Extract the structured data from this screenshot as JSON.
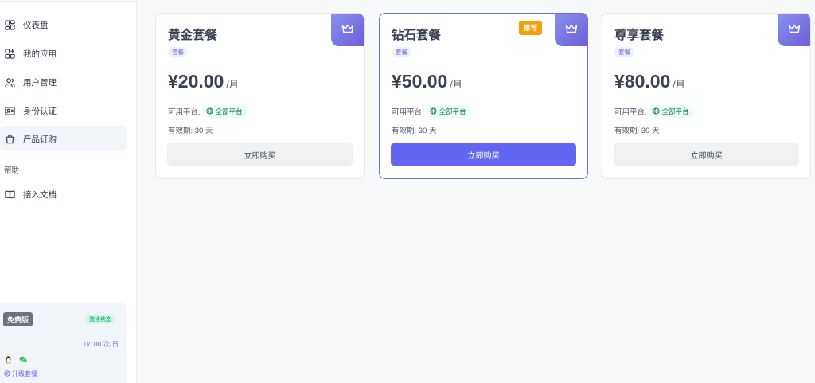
{
  "sidebar": {
    "items": [
      {
        "label": "仪表盘",
        "icon": "dashboard-icon"
      },
      {
        "label": "我的应用",
        "icon": "apps-icon"
      },
      {
        "label": "用户管理",
        "icon": "users-icon"
      },
      {
        "label": "身份认证",
        "icon": "id-card-icon"
      },
      {
        "label": "产品订购",
        "icon": "shopping-bag-icon",
        "active": true
      }
    ],
    "help_section": "帮助",
    "help_items": [
      {
        "label": "接入文档",
        "icon": "book-icon"
      }
    ],
    "plan": {
      "name": "免费版",
      "status": "激活状态",
      "usage": "0/100 次/日",
      "upgrade": "升级套餐",
      "contact_icons": [
        "qq-icon",
        "wechat-icon"
      ]
    }
  },
  "cards": [
    {
      "title": "黄金套餐",
      "tag": "套餐",
      "price": "¥20.00",
      "unit": "/月",
      "platform_label": "可用平台:",
      "platform": "全部平台",
      "validity": "有效期: 30 天",
      "button": "立即购买",
      "recommended": false
    },
    {
      "title": "钻石套餐",
      "tag": "套餐",
      "price": "¥50.00",
      "unit": "/月",
      "platform_label": "可用平台:",
      "platform": "全部平台",
      "validity": "有效期: 30 天",
      "button": "立即购买",
      "recommended": true,
      "badge": "推荐"
    },
    {
      "title": "尊享套餐",
      "tag": "套餐",
      "price": "¥80.00",
      "unit": "/月",
      "platform_label": "可用平台:",
      "platform": "全部平台",
      "validity": "有效期: 30 天",
      "button": "立即购买",
      "recommended": false
    }
  ],
  "colors": {
    "accent": "#6366f1",
    "badge_orange": "#f59e0b",
    "crown_gradient_start": "#8b8ff0",
    "crown_gradient_end": "#6d5fd8",
    "platform_green": "#047857"
  }
}
